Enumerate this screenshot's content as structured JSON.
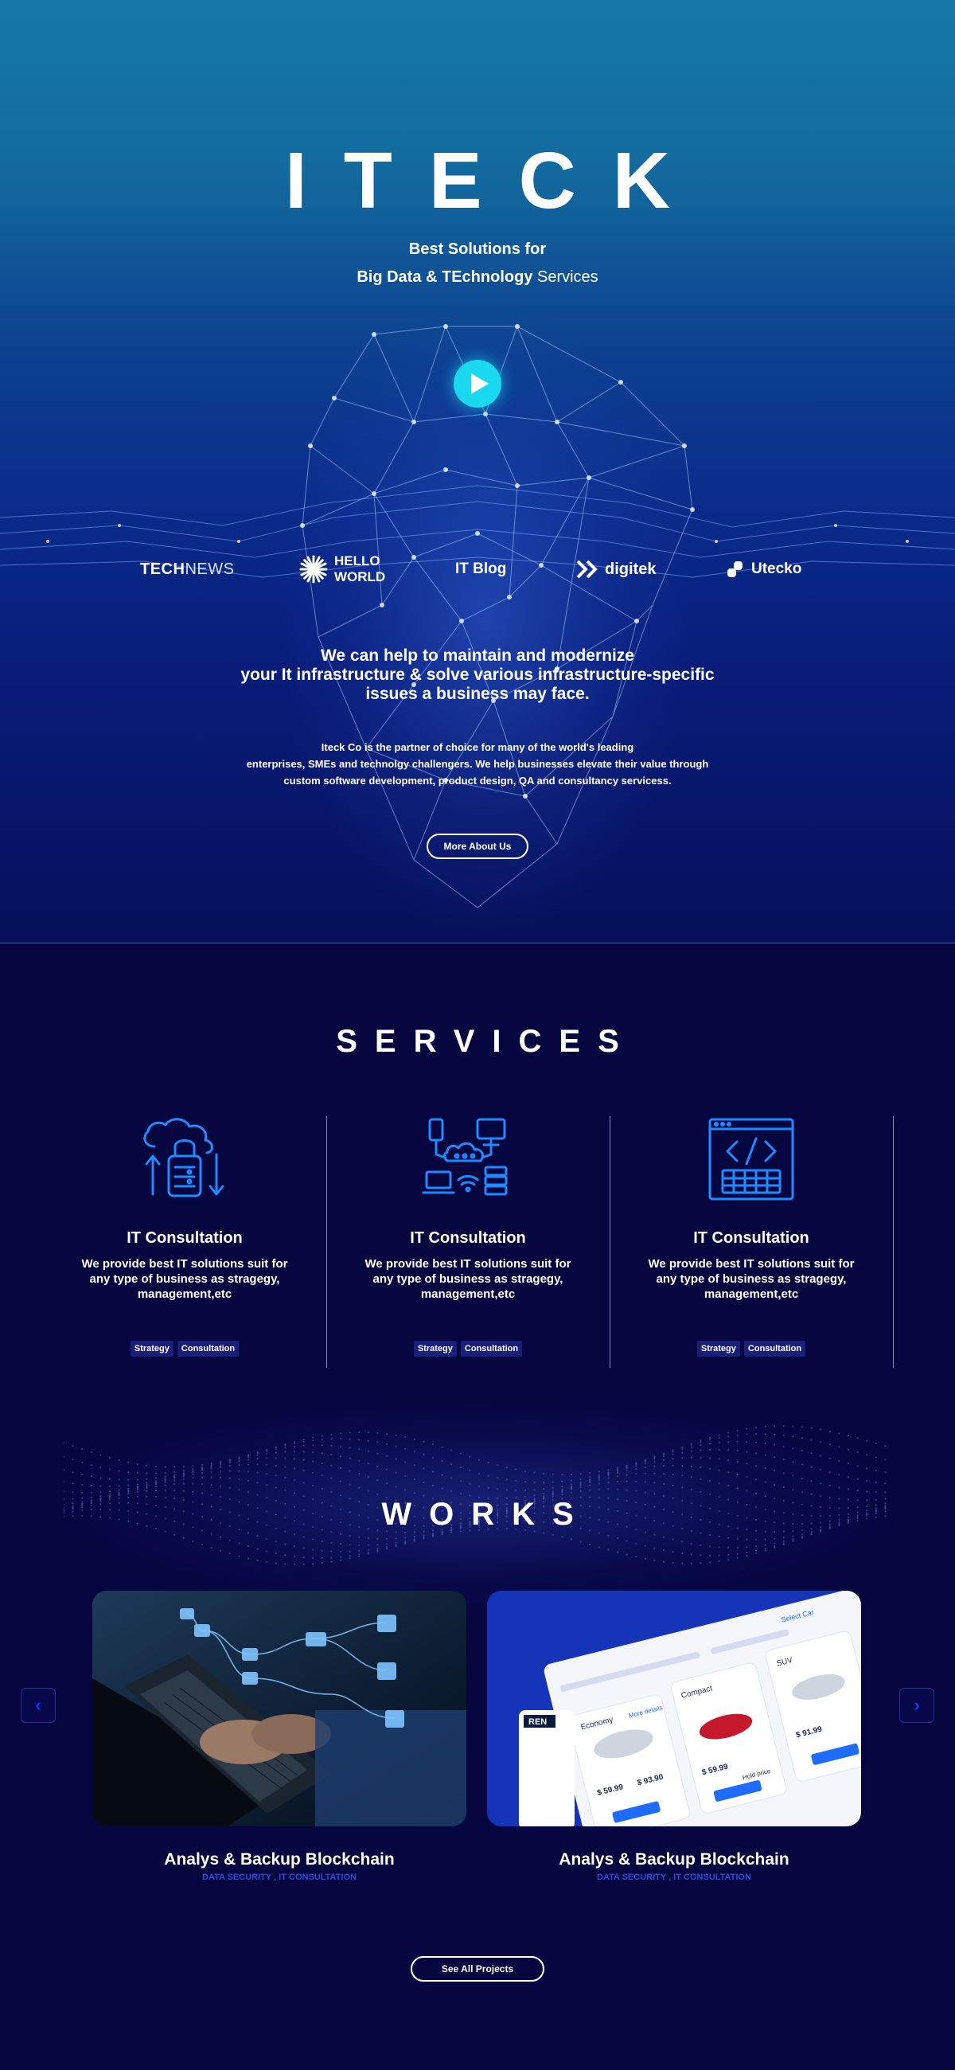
{
  "hero": {
    "logo": "ITECK",
    "tagline_line1": "Best Solutions for",
    "tagline_bold": "Big Data & TEchnology",
    "tagline_light": " Services",
    "heading_lines": [
      "We can help to  maintain and modernize",
      "your It infrastructure & solve various infrastructure-specific",
      "issues a business may face."
    ],
    "description_lines": [
      "Iteck Co is the partner of choice for many of the world's leading",
      "enterprises, SMEs and technolgy challengers. We help businesses elevate their value through",
      "custom software development, product design, QA and consultancy servicess."
    ],
    "more_button": "More About Us"
  },
  "partners": {
    "technews_a": "TECH",
    "technews_b": "NEWS",
    "helloworld_a": "HELLO",
    "helloworld_b": "WORLD",
    "itblog": "IT Blog",
    "digitek": "digitek",
    "utecko": "Utecko"
  },
  "services": {
    "title": "SERVICES",
    "items": [
      {
        "name": "IT Consultation",
        "desc_lines": [
          "We provide best IT solutions suit for",
          "any type of business as stragegy,",
          "management,etc"
        ],
        "tags": [
          "Strategy",
          "Consultation"
        ]
      },
      {
        "name": "IT Consultation",
        "desc_lines": [
          "We provide best IT solutions suit for",
          "any type of business as stragegy,",
          "management,etc"
        ],
        "tags": [
          "Strategy",
          "Consultation"
        ]
      },
      {
        "name": "IT Consultation",
        "desc_lines": [
          "We provide best IT solutions suit for",
          "any type of business as stragegy,",
          "management,etc"
        ],
        "tags": [
          "Strategy",
          "Consultation"
        ]
      }
    ]
  },
  "works": {
    "title": "WORKS",
    "items": [
      {
        "title": "Analys & Backup Blockchain",
        "meta": "DATA SECURITY , IT CONSULTATION"
      },
      {
        "title": "Analys & Backup Blockchain",
        "meta": "DATA SECURITY , IT CONSULTATION"
      }
    ],
    "prev_icon": "chevron-left-icon",
    "next_icon": "chevron-right-icon",
    "see_all_button": "See All Projects"
  },
  "mockup": {
    "logo": "REN",
    "economy": "Economy",
    "compact": "Compact",
    "suv": "SUV",
    "price_a": "$ 59.99",
    "price_b": "$ 93.90",
    "price_c": "$ 59.99",
    "price_d": "$ 91.99",
    "select_label": "Select Car",
    "more_details": "More details",
    "hold_price": "Hold price"
  },
  "colors": {
    "accent_cyan": "#19d8f0",
    "icon_blue": "#1e8bff",
    "meta_blue": "#2a4de0",
    "background": "#05053f"
  }
}
